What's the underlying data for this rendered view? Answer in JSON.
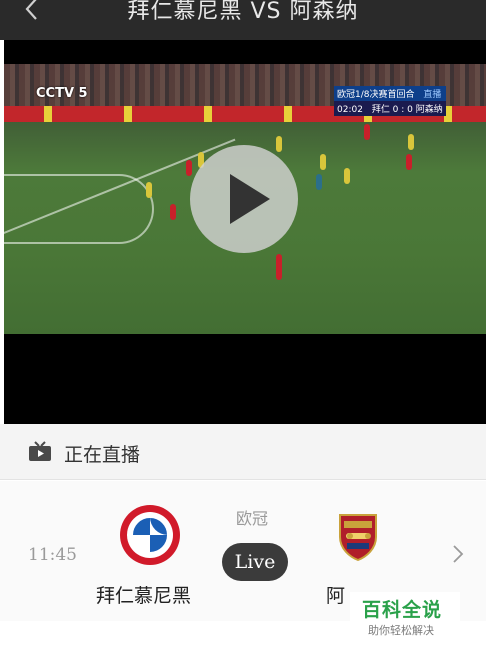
{
  "header": {
    "back_icon": "chevron-left-icon",
    "title": "拜仁慕尼黑 VS 阿森纳"
  },
  "video": {
    "channel": "CCTV 5",
    "scoreboard": {
      "competition": "欧冠1/8决赛首回合",
      "status": "直播",
      "clock": "02:02",
      "score": "拜仁 0 : 0 阿森纳"
    },
    "play_icon": "play-icon",
    "colors": {
      "play_button": "#d2d2d2",
      "play_triangle": "#333333"
    }
  },
  "live_section": {
    "icon": "tv-icon",
    "title": "正在直播"
  },
  "match": {
    "time": "11:45",
    "league": "欧冠",
    "status_pill": "Live",
    "home_team": {
      "name": "拜仁慕尼黑",
      "logo_icon": "bayern-logo-icon"
    },
    "away_team": {
      "name": "阿",
      "logo_icon": "arsenal-logo-icon"
    },
    "detail_icon": "chevron-right-icon"
  },
  "watermark": {
    "title": "百科全说",
    "subtitle": "助你轻松解决"
  }
}
